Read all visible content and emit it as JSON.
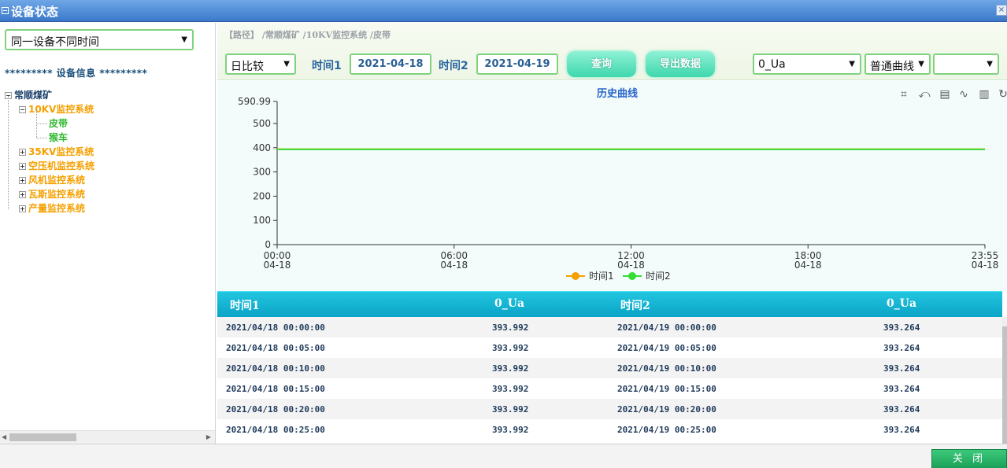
{
  "window": {
    "title": "设备状态",
    "close_glyph": "×"
  },
  "left": {
    "mode_select": "同一设备不同时间",
    "device_info_header": "********* 设备信息 *********",
    "tree": {
      "root": "常顺煤矿",
      "systems": [
        {
          "label": "10KV监控系统",
          "expanded": true,
          "children": [
            "皮带",
            "猴车"
          ]
        },
        {
          "label": "35KV监控系统",
          "expanded": false
        },
        {
          "label": "空压机监控系统",
          "expanded": false
        },
        {
          "label": "风机监控系统",
          "expanded": false
        },
        {
          "label": "瓦斯监控系统",
          "expanded": false
        },
        {
          "label": "产量监控系统",
          "expanded": false
        }
      ]
    }
  },
  "toolbar": {
    "breadcrumb": "【路径】 /常顺煤矿 /10KV监控系统 /皮带",
    "compare_select": "日比较",
    "time1_label": "时间1",
    "time1_value": "2021-04-18",
    "time2_label": "时间2",
    "time2_value": "2021-04-19",
    "query_label": "查询",
    "export_label": "导出数据",
    "param_select": "0_Ua",
    "curve_select": "普通曲线",
    "extra_select": ""
  },
  "chart_data": {
    "type": "line",
    "title": "历史曲线",
    "x_ticks": [
      {
        "pos": 0,
        "line1": "00:00",
        "line2": "04-18"
      },
      {
        "pos": 0.25,
        "line1": "06:00",
        "line2": "04-18"
      },
      {
        "pos": 0.5,
        "line1": "12:00",
        "line2": "04-18"
      },
      {
        "pos": 0.75,
        "line1": "18:00",
        "line2": "04-18"
      },
      {
        "pos": 1.0,
        "line1": "23:55",
        "line2": "04-18"
      }
    ],
    "y_ticks": [
      0,
      100,
      200,
      300,
      400,
      500,
      590.99
    ],
    "ylim": [
      0,
      590.99
    ],
    "series": [
      {
        "name": "时间1",
        "color": "#f5a000",
        "y_start": 393.992,
        "y_end": 393.992
      },
      {
        "name": "时间2",
        "color": "#33dd33",
        "y_start": 393.264,
        "y_end": 393.264
      }
    ],
    "legend_position": "bottom-center"
  },
  "table": {
    "headers": [
      "时间1",
      "0_Ua",
      "时间2",
      "0_Ua"
    ],
    "rows": [
      [
        "2021/04/18 00:00:00",
        "393.992",
        "2021/04/19 00:00:00",
        "393.264"
      ],
      [
        "2021/04/18 00:05:00",
        "393.992",
        "2021/04/19 00:05:00",
        "393.264"
      ],
      [
        "2021/04/18 00:10:00",
        "393.992",
        "2021/04/19 00:10:00",
        "393.264"
      ],
      [
        "2021/04/18 00:15:00",
        "393.992",
        "2021/04/19 00:15:00",
        "393.264"
      ],
      [
        "2021/04/18 00:20:00",
        "393.992",
        "2021/04/19 00:20:00",
        "393.264"
      ],
      [
        "2021/04/18 00:25:00",
        "393.992",
        "2021/04/19 00:25:00",
        "393.264"
      ]
    ]
  },
  "footer": {
    "close_label": "关 闭"
  },
  "icons": {
    "chart_tools": [
      "zoom-icon",
      "zoom-reset-icon",
      "data-view-icon",
      "line-chart-icon",
      "bar-chart-icon",
      "restore-icon"
    ]
  }
}
